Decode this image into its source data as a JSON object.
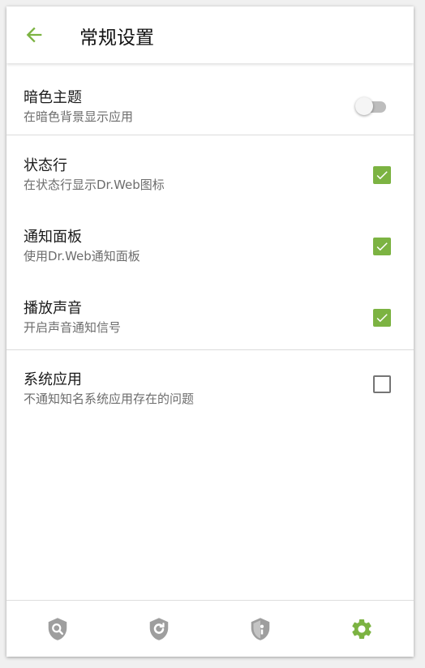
{
  "appbar": {
    "title": "常规设置",
    "back_icon": "arrow-back-icon",
    "accent": "#7cb342"
  },
  "settings": {
    "dark_theme": {
      "title": "暗色主题",
      "subtitle": "在暗色背景显示应用",
      "enabled": false
    },
    "status_bar": {
      "title": "状态行",
      "subtitle": "在状态行显示Dr.Web图标",
      "checked": true
    },
    "notification_panel": {
      "title": "通知面板",
      "subtitle": "使用Dr.Web通知面板",
      "checked": true
    },
    "play_sound": {
      "title": "播放声音",
      "subtitle": "开启声音通知信号",
      "checked": true
    },
    "system_apps": {
      "title": "系统应用",
      "subtitle": "不通知知名系统应用存在的问题",
      "checked": false
    }
  },
  "bottom_nav": {
    "items": [
      {
        "icon": "shield-search-icon",
        "active": false
      },
      {
        "icon": "shield-refresh-icon",
        "active": false
      },
      {
        "icon": "shield-privacy-icon",
        "active": false
      },
      {
        "icon": "gear-icon",
        "active": true
      }
    ],
    "active_color": "#7cb342",
    "inactive_color": "#9e9e9e"
  }
}
